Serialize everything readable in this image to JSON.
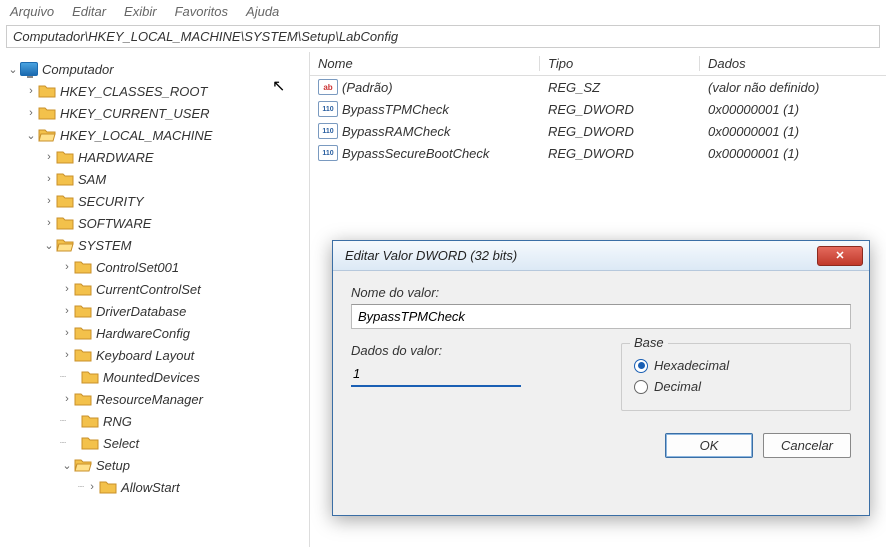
{
  "menu": {
    "items": [
      "Arquivo",
      "Editar",
      "Exibir",
      "Favoritos",
      "Ajuda"
    ]
  },
  "path": "Computador\\HKEY_LOCAL_MACHINE\\SYSTEM\\Setup\\LabConfig",
  "tree": {
    "root": "Computador",
    "hkcr": "HKEY_CLASSES_ROOT",
    "hkcu": "HKEY_CURRENT_USER",
    "hklm": "HKEY_LOCAL_MACHINE",
    "hardware": "HARDWARE",
    "sam": "SAM",
    "security": "SECURITY",
    "software": "SOFTWARE",
    "system": "SYSTEM",
    "cs001": "ControlSet001",
    "ccs": "CurrentControlSet",
    "driverdb": "DriverDatabase",
    "hwconfig": "HardwareConfig",
    "kblayout": "Keyboard Layout",
    "mounted": "MountedDevices",
    "resmgr": "ResourceManager",
    "rng": "RNG",
    "select": "Select",
    "setup": "Setup",
    "allowstart": "AllowStart"
  },
  "values": {
    "headers": {
      "name": "Nome",
      "type": "Tipo",
      "data": "Dados"
    },
    "rows": [
      {
        "icon": "ab",
        "name": "(Padrão)",
        "type": "REG_SZ",
        "data": "(valor não definido)"
      },
      {
        "icon": "dword",
        "name": "BypassTPMCheck",
        "type": "REG_DWORD",
        "data": "0x00000001 (1)"
      },
      {
        "icon": "dword",
        "name": "BypassRAMCheck",
        "type": "REG_DWORD",
        "data": "0x00000001 (1)"
      },
      {
        "icon": "dword",
        "name": "BypassSecureBootCheck",
        "type": "REG_DWORD",
        "data": "0x00000001 (1)"
      }
    ]
  },
  "dialog": {
    "title": "Editar Valor DWORD (32 bits)",
    "name_label": "Nome do valor:",
    "name_value": "BypassTPMCheck",
    "data_label": "Dados do valor:",
    "data_value": "1",
    "base_label": "Base",
    "hex": "Hexadecimal",
    "dec": "Decimal",
    "ok": "OK",
    "cancel": "Cancelar"
  }
}
